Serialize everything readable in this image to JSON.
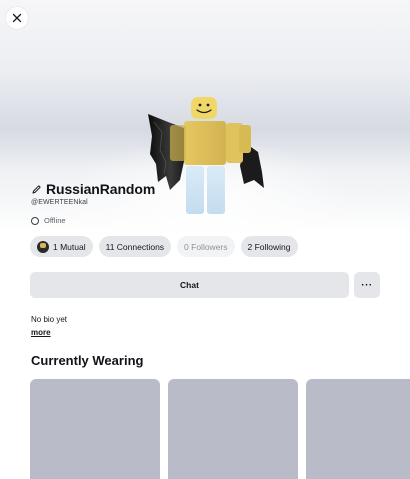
{
  "profile": {
    "display_name": "RussianRandom",
    "username": "@EWERTEENkal",
    "status": "Offline"
  },
  "chips": {
    "mutual": "1 Mutual",
    "connections": "11 Connections",
    "followers": "0 Followers",
    "following": "2 Following"
  },
  "actions": {
    "chat_label": "Chat",
    "more_label": "···"
  },
  "bio": {
    "text": "No bio yet",
    "more_label": "more"
  },
  "sections": {
    "currently_wearing": "Currently Wearing"
  },
  "wearing_items": [
    {},
    {},
    {}
  ],
  "icons": {
    "close": "close-icon",
    "edit": "pencil-icon",
    "status": "status-ring-icon"
  },
  "colors": {
    "chip_bg": "#e5e6ea",
    "card_placeholder": "#b9bcc8",
    "avatar_skin": "#e8cf6a",
    "avatar_legs": "#cfe3f2"
  }
}
